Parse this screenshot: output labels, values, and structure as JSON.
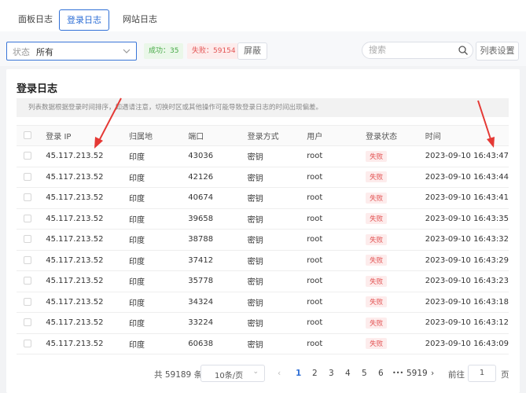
{
  "tabs": [
    {
      "label": "面板日志",
      "active": false
    },
    {
      "label": "登录日志",
      "active": true
    },
    {
      "label": "网站日志",
      "active": false
    }
  ],
  "filter": {
    "status_label": "状态",
    "status_value": "所有"
  },
  "badges": {
    "success": "成功：35",
    "fail": "失败：59154"
  },
  "mask_button": "屏蔽",
  "search": {
    "placeholder": "搜索"
  },
  "list_settings_button": "列表设置",
  "panel": {
    "title": "登录日志",
    "notice": "列表数据根据登录时间排序，如遇请注意，切换时区或其他操作可能导致登录日志的时间出现偏差。"
  },
  "table": {
    "headers": [
      "登录 IP",
      "归属地",
      "端口",
      "登录方式",
      "用户",
      "登录状态",
      "时间"
    ],
    "rows": [
      {
        "ip": "45.117.213.52",
        "loc": "印度",
        "port": "43036",
        "method": "密钥",
        "user": "root",
        "status": "失败",
        "time": "2023-09-10 16:43:47"
      },
      {
        "ip": "45.117.213.52",
        "loc": "印度",
        "port": "42126",
        "method": "密钥",
        "user": "root",
        "status": "失败",
        "time": "2023-09-10 16:43:44"
      },
      {
        "ip": "45.117.213.52",
        "loc": "印度",
        "port": "40674",
        "method": "密钥",
        "user": "root",
        "status": "失败",
        "time": "2023-09-10 16:43:41"
      },
      {
        "ip": "45.117.213.52",
        "loc": "印度",
        "port": "39658",
        "method": "密钥",
        "user": "root",
        "status": "失败",
        "time": "2023-09-10 16:43:35"
      },
      {
        "ip": "45.117.213.52",
        "loc": "印度",
        "port": "38788",
        "method": "密钥",
        "user": "root",
        "status": "失败",
        "time": "2023-09-10 16:43:32"
      },
      {
        "ip": "45.117.213.52",
        "loc": "印度",
        "port": "37412",
        "method": "密钥",
        "user": "root",
        "status": "失败",
        "time": "2023-09-10 16:43:29"
      },
      {
        "ip": "45.117.213.52",
        "loc": "印度",
        "port": "35778",
        "method": "密钥",
        "user": "root",
        "status": "失败",
        "time": "2023-09-10 16:43:23"
      },
      {
        "ip": "45.117.213.52",
        "loc": "印度",
        "port": "34324",
        "method": "密钥",
        "user": "root",
        "status": "失败",
        "time": "2023-09-10 16:43:18"
      },
      {
        "ip": "45.117.213.52",
        "loc": "印度",
        "port": "33224",
        "method": "密钥",
        "user": "root",
        "status": "失败",
        "time": "2023-09-10 16:43:12"
      },
      {
        "ip": "45.117.213.52",
        "loc": "印度",
        "port": "60638",
        "method": "密钥",
        "user": "root",
        "status": "失败",
        "time": "2023-09-10 16:43:09"
      }
    ]
  },
  "pager": {
    "total": "共 59189 条",
    "page_size": "10条/页",
    "prev": "‹",
    "pages": [
      "1",
      "2",
      "3",
      "4",
      "5",
      "6",
      "•••",
      "5919"
    ],
    "current": "1",
    "next": "›",
    "goto_label": "前往",
    "goto_value": "1",
    "unit": "页"
  },
  "colors": {
    "accent": "#2f6fd6",
    "fail": "#e35454",
    "success": "#45a845",
    "arrow": "#e53935"
  }
}
